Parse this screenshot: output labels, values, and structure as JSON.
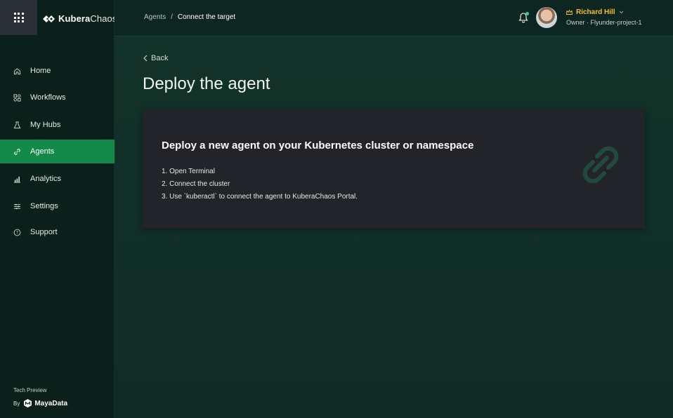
{
  "brand": {
    "name_bold": "Kubera",
    "name_light": "Chaos"
  },
  "sidebar": {
    "items": [
      {
        "label": "Home",
        "icon": "home-icon",
        "active": false
      },
      {
        "label": "Workflows",
        "icon": "workflows-icon",
        "active": false
      },
      {
        "label": "My Hubs",
        "icon": "flask-icon",
        "active": false
      },
      {
        "label": "Agents",
        "icon": "link-icon",
        "active": true
      },
      {
        "label": "Analytics",
        "icon": "bar-chart-icon",
        "active": false
      },
      {
        "label": "Settings",
        "icon": "sliders-icon",
        "active": false
      },
      {
        "label": "Support",
        "icon": "help-icon",
        "active": false
      }
    ],
    "footer": {
      "tech_preview": "Tech Preview",
      "by": "By",
      "company": "MayaData"
    }
  },
  "header": {
    "breadcrumb": {
      "parent": "Agents",
      "separator": "/",
      "current": "Connect the target"
    },
    "user": {
      "name": "Richard Hill",
      "role": "Owner · Flyunder-project-1"
    }
  },
  "main": {
    "back_label": "Back",
    "title": "Deploy the agent",
    "card": {
      "title": "Deploy a new agent on your Kubernetes cluster or namespace",
      "steps": [
        "1. Open Terminal",
        "2. Connect the cluster",
        "3. Use `kuberactl` to connect the agent to KuberaChaos Portal."
      ]
    }
  },
  "colors": {
    "accent": "#148a4a",
    "user_name": "#f3c12c",
    "notification_dot": "#2fd08a",
    "card_bg": "#23242a",
    "sidebar_bg": "#0b1f1b"
  }
}
